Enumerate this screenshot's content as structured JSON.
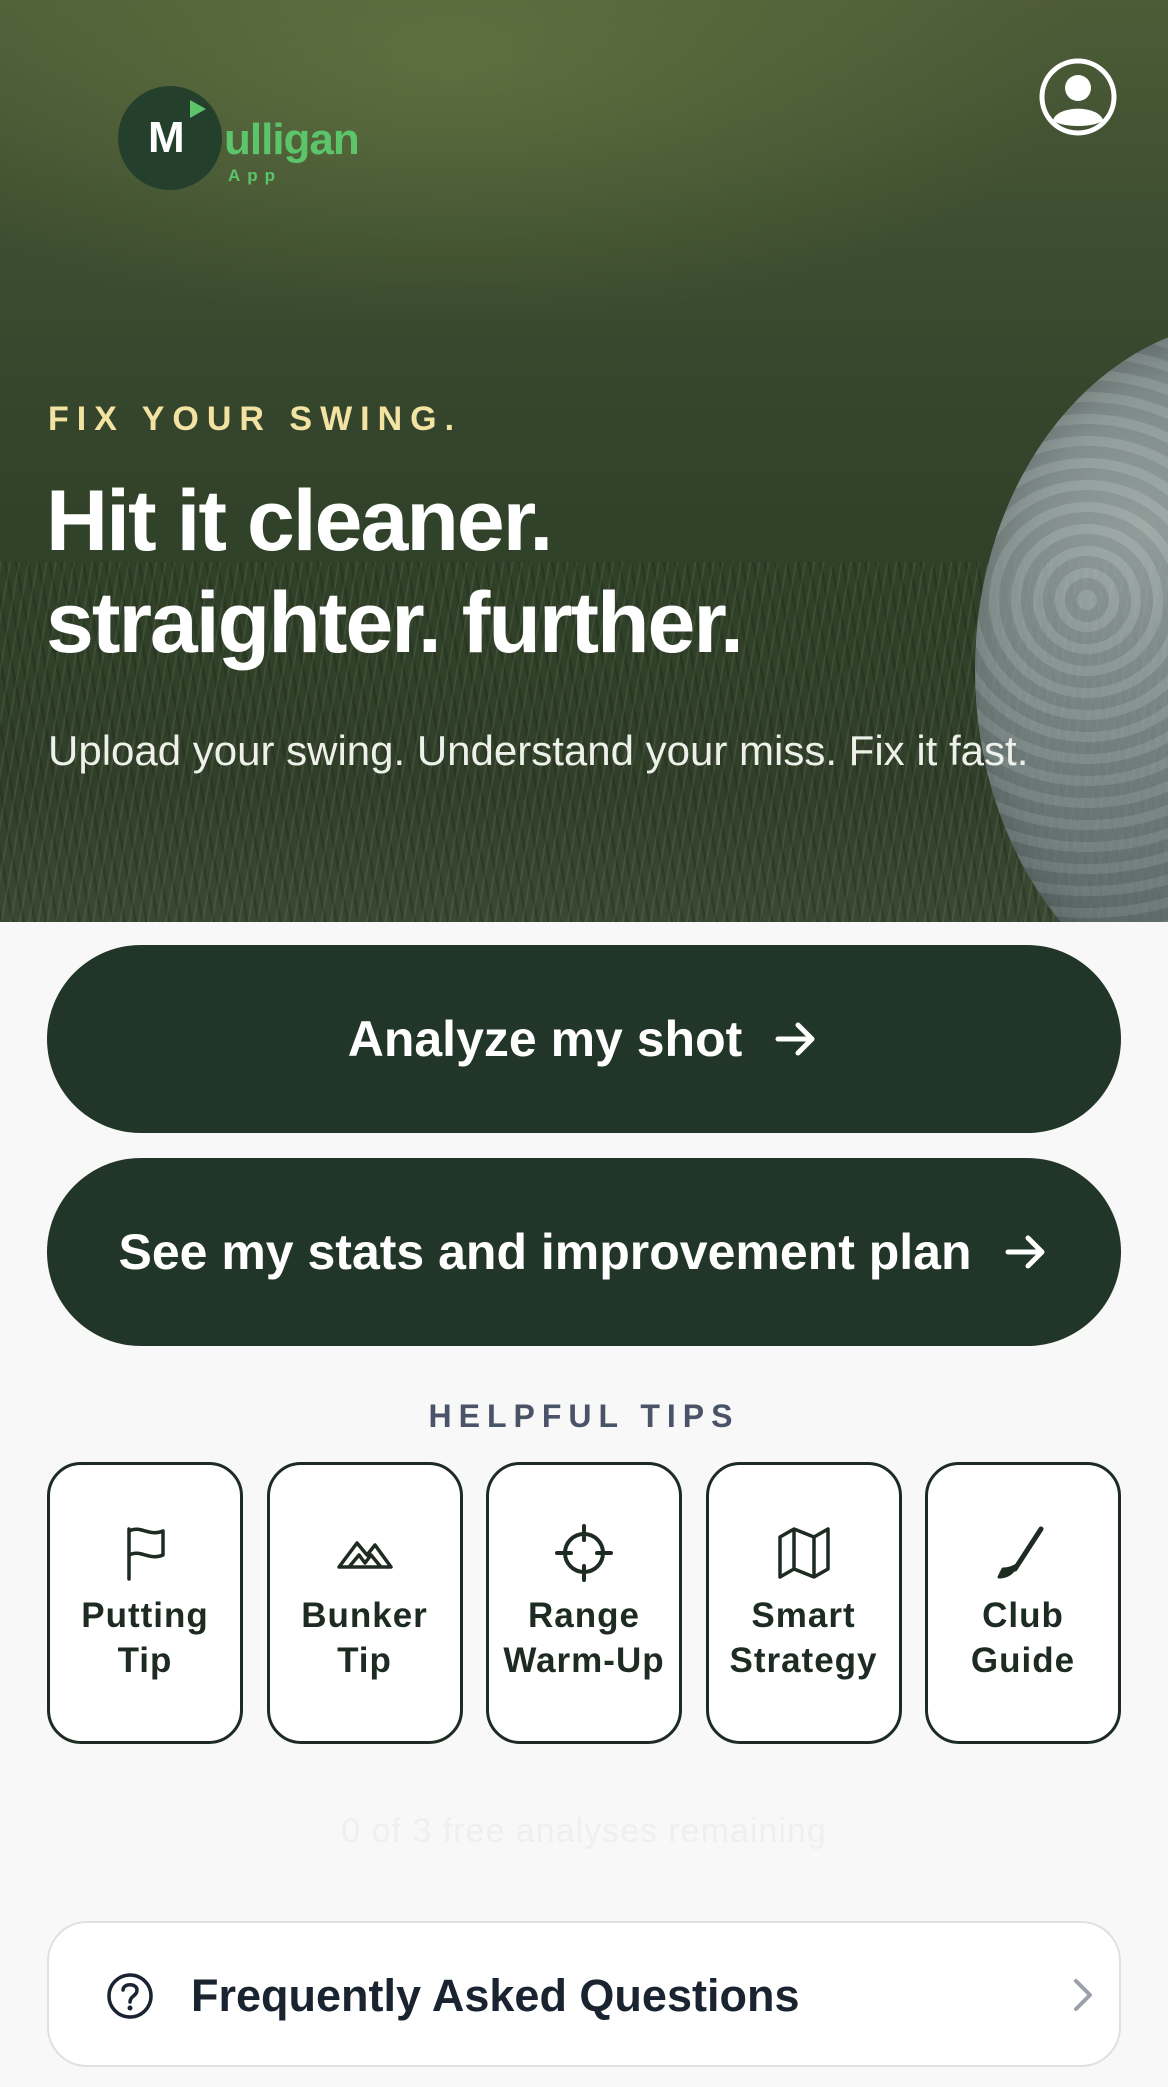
{
  "brand": {
    "logo_letter": "M",
    "logo_word": "ulligan",
    "logo_sub": "App",
    "accent_color": "#5cc46a",
    "dark_color": "#213528"
  },
  "header": {
    "profile_icon": "user-circle-icon"
  },
  "hero": {
    "eyebrow": "FIX YOUR SWING.",
    "headline_line1": "Hit it cleaner.",
    "headline_line2": "straighter. further.",
    "subline": "Upload your swing. Understand your miss. Fix it fast."
  },
  "actions": {
    "analyze_label": "Analyze my shot",
    "stats_label": "See my stats and improvement plan",
    "arrow_icon": "arrow-right-icon"
  },
  "tips": {
    "heading": "HELPFUL TIPS",
    "items": [
      {
        "label": "Putting Tip",
        "icon": "flag-icon"
      },
      {
        "label": "Bunker Tip",
        "icon": "bunker-icon"
      },
      {
        "label": "Range Warm-Up",
        "icon": "crosshair-icon"
      },
      {
        "label": "Smart Strategy",
        "icon": "map-icon"
      },
      {
        "label": "Club Guide",
        "icon": "golf-club-icon"
      }
    ]
  },
  "status": {
    "remaining_text": "0 of 3 free analyses remaining"
  },
  "faq": {
    "label": "Frequently Asked Questions",
    "icon": "question-circle-icon",
    "chevron": "chevron-right-icon"
  }
}
